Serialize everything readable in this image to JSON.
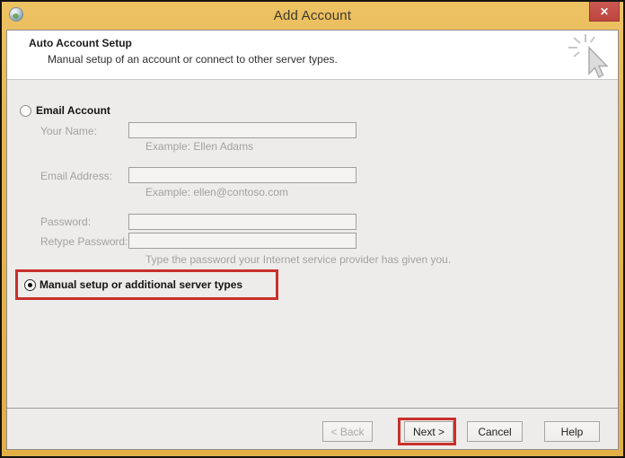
{
  "window": {
    "title": "Add Account",
    "close_glyph": "✕"
  },
  "header": {
    "title": "Auto Account Setup",
    "subtitle": "Manual setup of an account or connect to other server types."
  },
  "email_account": {
    "radio_label": "Email Account",
    "selected": false,
    "fields": [
      {
        "label": "Your Name:",
        "value": "",
        "example": "Example: Ellen Adams"
      },
      {
        "label": "Email Address:",
        "value": "",
        "example": "Example: ellen@contoso.com"
      },
      {
        "label": "Password:",
        "value": ""
      },
      {
        "label": "Retype Password:",
        "value": ""
      }
    ],
    "password_hint": "Type the password your Internet service provider has given you."
  },
  "manual_setup": {
    "radio_label": "Manual setup or additional server types",
    "selected": true
  },
  "buttons": {
    "back": "< Back",
    "next": "Next >",
    "cancel": "Cancel",
    "help": "Help"
  },
  "colors": {
    "titlebar_gold": "#E7B651",
    "close_red": "#C04A45",
    "annotation_red": "#C8302B",
    "content_gray": "#EDECEA",
    "header_white": "#FFFFFF"
  }
}
